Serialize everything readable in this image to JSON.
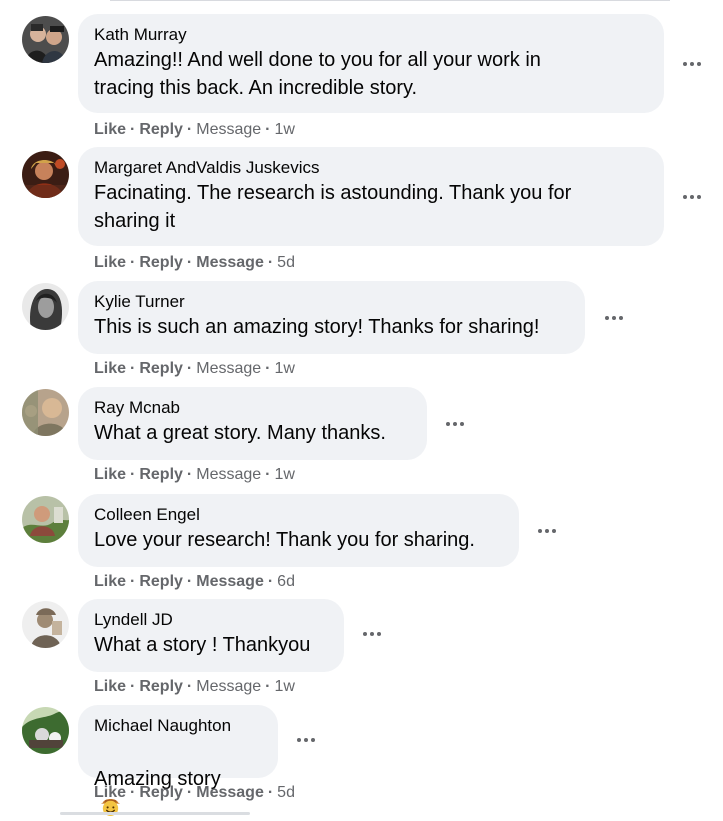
{
  "actions": {
    "like": "Like",
    "reply": "Reply",
    "message": "Message",
    "separator": "·"
  },
  "comments": [
    {
      "author": "Kath Murray",
      "text": "Amazing!! And well done to you for all your work in\ntracing this back. An incredible story.",
      "time": "1w",
      "message_bold": false
    },
    {
      "author": "Margaret AndValdis Juskevics",
      "text": "Facinating. The research is astounding. Thank you for\nsharing it",
      "time": "5d",
      "message_bold": true
    },
    {
      "author": "Kylie Turner",
      "text": "This is such an amazing story! Thanks for sharing!",
      "time": "1w",
      "message_bold": false
    },
    {
      "author": "Ray Mcnab",
      "text": "What a great story. Many thanks.",
      "time": "1w",
      "message_bold": false
    },
    {
      "author": "Colleen Engel",
      "text": "Love your research! Thank you for sharing.",
      "time": "6d",
      "message_bold": true
    },
    {
      "author": "Lyndell JD",
      "text": "What a story ! Thankyou",
      "time": "1w",
      "message_bold": false
    },
    {
      "author": "Michael Naughton",
      "text": "Amazing story",
      "emoji": "cowboy-hat-face-icon",
      "time": "5d",
      "message_bold": true
    }
  ],
  "colors": {
    "bubble": "#f0f2f5",
    "meta": "#65676b",
    "text": "#050505"
  }
}
